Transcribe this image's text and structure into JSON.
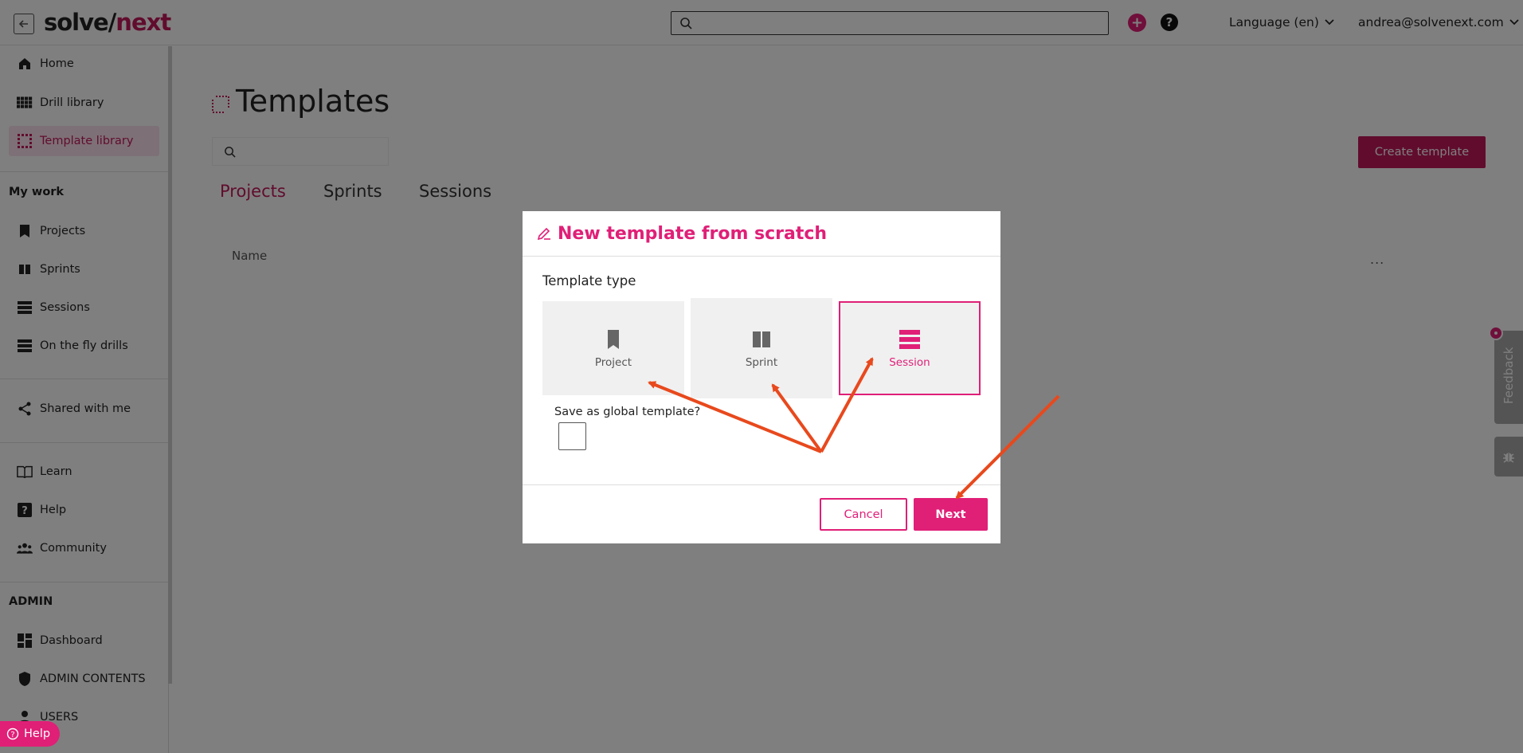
{
  "app": {
    "logo_text_main": "solve/",
    "logo_text_accent": "next",
    "language_label": "Language (en)",
    "user_email": "andrea@solvenext.com",
    "search_placeholder": ""
  },
  "sidebar": {
    "items": [
      {
        "label": "Home",
        "icon": "home-icon"
      },
      {
        "label": "Drill library",
        "icon": "grid-icon"
      },
      {
        "label": "Template library",
        "icon": "template-icon",
        "active": true
      }
    ],
    "my_work_title": "My work",
    "my_work_items": [
      {
        "label": "Projects",
        "icon": "bookmark-icon"
      },
      {
        "label": "Sprints",
        "icon": "sprint-icon"
      },
      {
        "label": "Sessions",
        "icon": "list-icon"
      },
      {
        "label": "On the fly drills",
        "icon": "list-icon"
      }
    ],
    "shared_label": "Shared with me",
    "learn_items": [
      {
        "label": "Learn",
        "icon": "book-icon"
      },
      {
        "label": "Help",
        "icon": "help-icon"
      },
      {
        "label": "Community",
        "icon": "people-icon"
      }
    ],
    "admin_title": "ADMIN",
    "admin_items": [
      {
        "label": "Dashboard",
        "icon": "dashboard-icon"
      },
      {
        "label": "ADMIN CONTENTS",
        "icon": "shield-icon"
      },
      {
        "label": "USERS",
        "icon": "users-icon"
      }
    ],
    "help_pill_label": "Help"
  },
  "main": {
    "title": "Templates",
    "create_button": "Create template",
    "tabs": [
      "Projects",
      "Sprints",
      "Sessions"
    ],
    "active_tab": "Projects",
    "column_name": "Name",
    "more_label": "..."
  },
  "modal": {
    "title": "New template from scratch",
    "type_label": "Template type",
    "types": [
      {
        "label": "Project",
        "icon": "bookmark-icon",
        "selected": false
      },
      {
        "label": "Sprint",
        "icon": "sprint-icon",
        "selected": false
      },
      {
        "label": "Session",
        "icon": "list-icon",
        "selected": true
      }
    ],
    "global_label": "Save as global template?",
    "global_checked": false,
    "cancel_label": "Cancel",
    "next_label": "Next"
  },
  "feedback": {
    "label": "Feedback"
  },
  "colors": {
    "accent": "#e01f77",
    "brand": "#c2185b",
    "arrow": "#e8491d"
  }
}
